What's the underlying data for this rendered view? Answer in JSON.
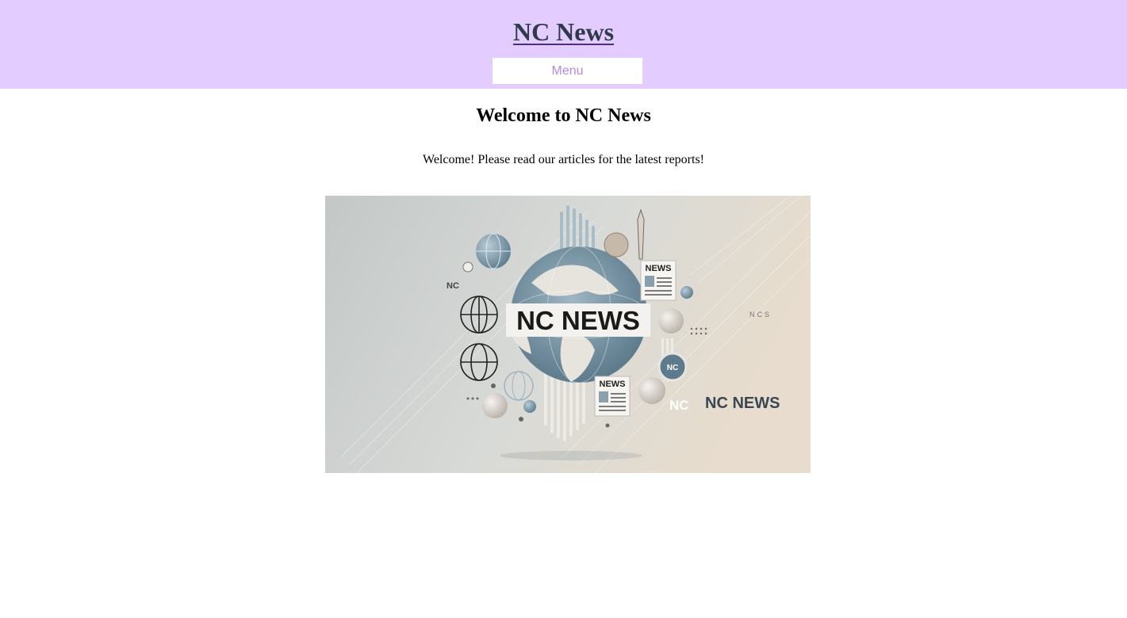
{
  "header": {
    "title": "NC News",
    "menu_label": "Menu"
  },
  "main": {
    "heading": "Welcome to NC News",
    "welcome_text": "Welcome! Please read our articles for the latest reports!"
  },
  "hero_image": {
    "banner_text": "NC NEWS",
    "badge_text_1": "NEWS",
    "badge_text_2": "NEWS",
    "corner_logo_nc": "NC",
    "corner_logo_news": "NC NEWS",
    "small_label_left": "NC",
    "small_label_right": "NCS",
    "orb_label": "NC"
  },
  "colors": {
    "header_bg": "#e3ccff",
    "menu_text": "#b48ae0",
    "title_text": "#2f3a4a"
  }
}
